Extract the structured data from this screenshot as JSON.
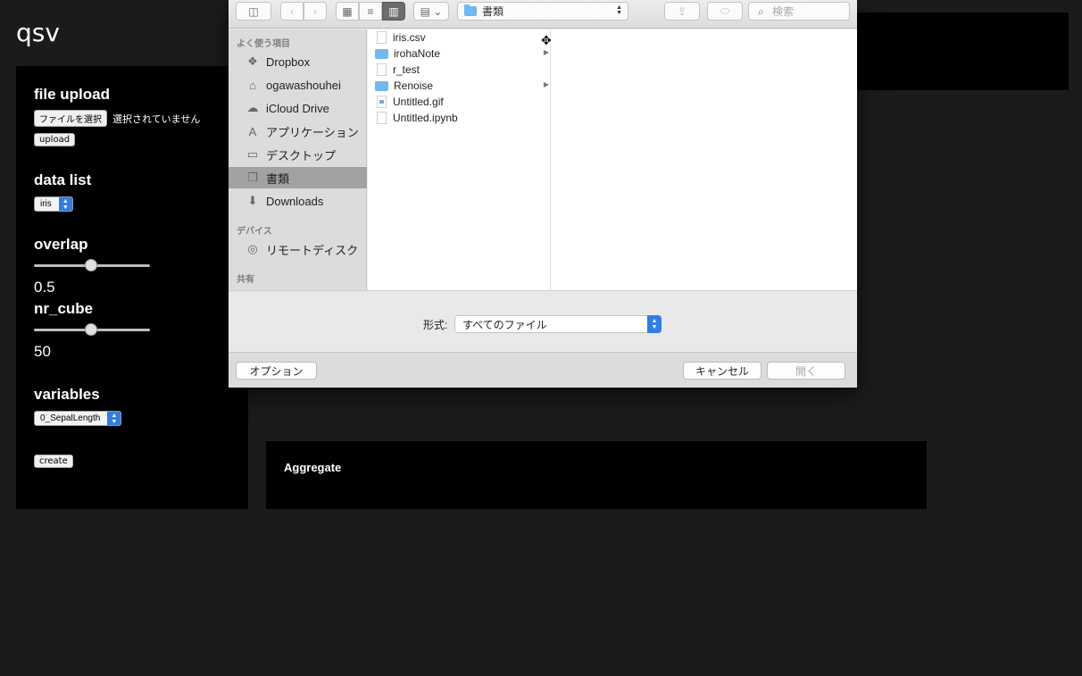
{
  "app": {
    "title": "qsv",
    "sidebar": {
      "file_upload": {
        "heading": "file upload",
        "choose_label": "ファイルを選択",
        "status": "選択されていません",
        "upload_label": "upload"
      },
      "data_list": {
        "heading": "data list",
        "value": "iris"
      },
      "overlap": {
        "heading": "overlap",
        "value": "0.5",
        "slider_fraction": 0.5
      },
      "nr_cube": {
        "heading": "nr_cube",
        "value": "50",
        "slider_fraction": 0.5
      },
      "variables": {
        "heading": "variables",
        "value": "0_SepalLength"
      },
      "create_label": "create"
    },
    "aggregate_label": "Aggregate"
  },
  "dialog": {
    "toolbar": {
      "location": "書類",
      "search_placeholder": "検索"
    },
    "sidebar": {
      "favorites_heading": "よく使う項目",
      "favorites": [
        {
          "label": "Dropbox",
          "icon": "dropbox-icon"
        },
        {
          "label": "ogawashouhei",
          "icon": "home-icon"
        },
        {
          "label": "iCloud Drive",
          "icon": "cloud-icon"
        },
        {
          "label": "アプリケーション",
          "icon": "applications-icon"
        },
        {
          "label": "デスクトップ",
          "icon": "desktop-icon"
        },
        {
          "label": "書類",
          "icon": "documents-icon",
          "selected": true
        },
        {
          "label": "Downloads",
          "icon": "downloads-icon"
        }
      ],
      "devices_heading": "デバイス",
      "devices": [
        {
          "label": "リモートディスク",
          "icon": "disc-icon"
        }
      ],
      "shared_heading": "共有"
    },
    "files": [
      {
        "name": "iris.csv",
        "kind": "file"
      },
      {
        "name": "irohaNote",
        "kind": "folder"
      },
      {
        "name": "r_test",
        "kind": "file"
      },
      {
        "name": "Renoise",
        "kind": "folder"
      },
      {
        "name": "Untitled.gif",
        "kind": "image"
      },
      {
        "name": "Untitled.ipynb",
        "kind": "file"
      }
    ],
    "format_label": "形式:",
    "format_value": "すべてのファイル",
    "options_label": "オプション",
    "cancel_label": "キャンセル",
    "open_label": "開く"
  }
}
